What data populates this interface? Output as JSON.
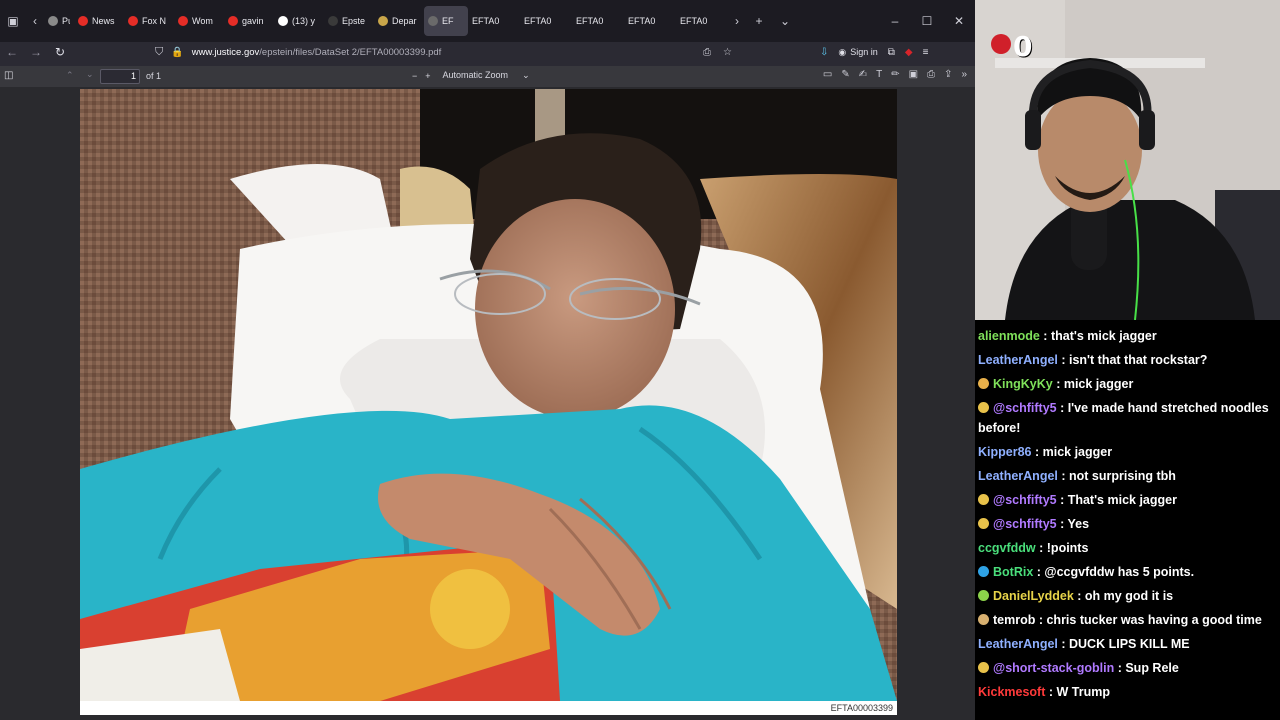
{
  "tabs": [
    {
      "label": "Pub",
      "favicon_color": "#8a8a8a"
    },
    {
      "label": "News",
      "favicon_color": "#e52d27"
    },
    {
      "label": "Fox N",
      "favicon_color": "#e52d27"
    },
    {
      "label": "Wom",
      "favicon_color": "#e52d27"
    },
    {
      "label": "gavin",
      "favicon_color": "#e52d27"
    },
    {
      "label": "(13) y",
      "favicon_color": "#ffffff"
    },
    {
      "label": "Epste",
      "favicon_color": "#3a3a3a"
    },
    {
      "label": "Depar",
      "favicon_color": "#c9a64a"
    },
    {
      "label": "EF",
      "favicon_color": "#6a6a6a",
      "active": true
    },
    {
      "label": "EFTA0",
      "favicon_color": ""
    },
    {
      "label": "EFTA0",
      "favicon_color": ""
    },
    {
      "label": "EFTA0",
      "favicon_color": ""
    },
    {
      "label": "EFTA0",
      "favicon_color": ""
    },
    {
      "label": "EFTA0",
      "favicon_color": ""
    }
  ],
  "navbar": {
    "url_domain": "www.justice.gov",
    "url_path": "/epstein/files/DataSet 2/EFTA00003399.pdf",
    "signin_label": "Sign in"
  },
  "pdf": {
    "page_number": "1",
    "page_count": "of 1",
    "zoom": "Automatic Zoom",
    "document_code": "EFTA00003399"
  },
  "stream": {
    "counter_value": "0"
  },
  "chat": [
    {
      "badge": "",
      "author": "alienmode",
      "color": "#7fe05a",
      "text": "that's mick jagger"
    },
    {
      "badge": "",
      "author": "LeatherAngel",
      "color": "#8fb0ff",
      "text": "isn't that that rockstar?"
    },
    {
      "badge": "#e8b04a",
      "author": "KingKyKy",
      "color": "#7fe05a",
      "text": "mick jagger"
    },
    {
      "badge": "#e8c24a",
      "author": "@schfifty5",
      "color": "#b07aff",
      "text": "I've made hand stretched noodles before!"
    },
    {
      "badge": "",
      "author": "Kipper86",
      "color": "#8fb0ff",
      "text": "mick jagger"
    },
    {
      "badge": "",
      "author": "LeatherAngel",
      "color": "#8fb0ff",
      "text": "not surprising tbh"
    },
    {
      "badge": "#e8c24a",
      "author": "@schfifty5",
      "color": "#b07aff",
      "text": "That's mick jagger"
    },
    {
      "badge": "#e8c24a",
      "author": "@schfifty5",
      "color": "#b07aff",
      "text": "Yes"
    },
    {
      "badge": "",
      "author": "ccgvfddw",
      "color": "#4ade7b",
      "text": "!points"
    },
    {
      "badge": "#2fa3e6",
      "author": "BotRix",
      "color": "#4ade7b",
      "text": "@ccgvfddw has 5 points."
    },
    {
      "badge": "#8bd24a",
      "author": "DanielLyddek",
      "color": "#e8d44a",
      "text": "oh my god it is"
    },
    {
      "badge": "#d8b070",
      "author": "temrob",
      "color": "#ffffff",
      "text": "chris tucker was having a good time"
    },
    {
      "badge": "",
      "author": "LeatherAngel",
      "color": "#8fb0ff",
      "text": "DUCK LIPS KILL ME"
    },
    {
      "badge": "#e8c24a",
      "author": "@short-stack-goblin",
      "color": "#b07aff",
      "text": "Sup Rele"
    },
    {
      "badge": "",
      "author": "Kickmesoft",
      "color": "#ff3a3a",
      "text": "W Trump"
    }
  ],
  "colors": {
    "tab_strip": "#1c1b22",
    "toolbar": "#2b2a33",
    "pdf_toolbar": "#38383d",
    "chat_bg": "#000000",
    "shirt": "#29b4c8"
  }
}
